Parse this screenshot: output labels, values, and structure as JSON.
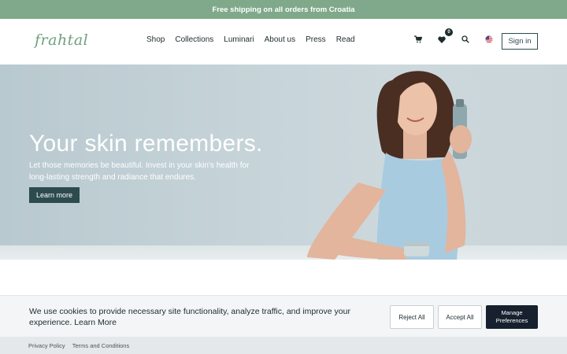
{
  "promo": {
    "text": "Free shipping on all orders from Croatia"
  },
  "header": {
    "logo": "frahtal",
    "nav": [
      "Shop",
      "Collections",
      "Luminari",
      "About us",
      "Press",
      "Read"
    ],
    "wishlist_count": "0",
    "signin_label": "Sign in",
    "icons": [
      "cart-icon",
      "heart-icon",
      "search-icon",
      "us-flag-icon"
    ]
  },
  "hero": {
    "title": "Your skin remembers.",
    "text": "Let those memories be beautiful. Invest in your skin’s health for long-lasting strength and radiance that endures.",
    "button": "Learn more"
  },
  "cookie": {
    "text": "We use cookies to provide necessary site functionality, analyze traffic, and improve your experience.",
    "link": "Learn More",
    "reject": "Reject All",
    "accept": "Accept All",
    "manage": "Manage Preferences"
  },
  "footer": {
    "links": [
      "Privacy Policy",
      "Terms and Conditions"
    ]
  },
  "colors": {
    "promo_bg": "#7fa98a",
    "accent": "#2d4b4f",
    "manage_bg": "#16202e"
  }
}
